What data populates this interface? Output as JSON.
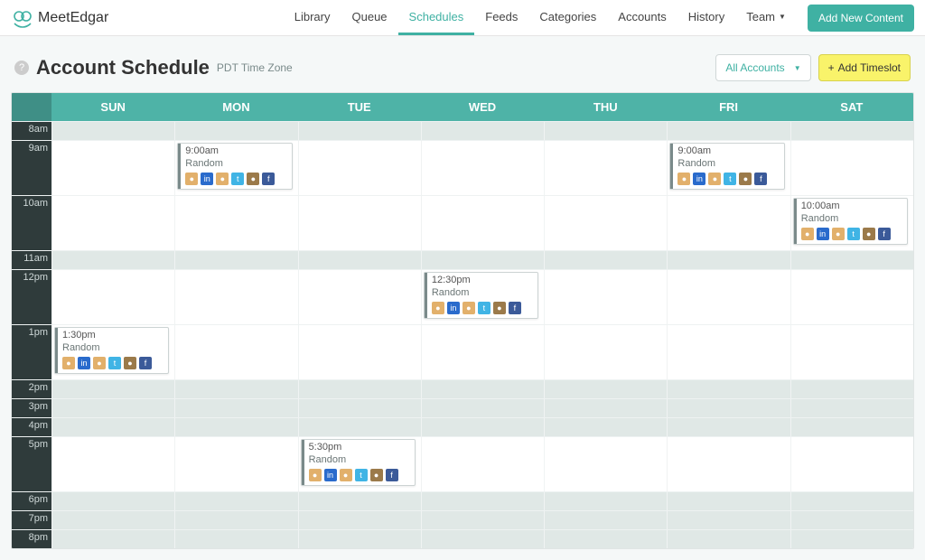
{
  "brand": {
    "name": "MeetEdgar"
  },
  "nav": {
    "items": [
      "Library",
      "Queue",
      "Schedules",
      "Feeds",
      "Categories",
      "Accounts",
      "History",
      "Team"
    ],
    "active": "Schedules",
    "addContent": "Add New Content"
  },
  "page": {
    "title": "Account Schedule",
    "tz": "PDT Time Zone",
    "accountsFilter": "All Accounts",
    "addTimeslot": "Add Timeslot"
  },
  "days": [
    "SUN",
    "MON",
    "TUE",
    "WED",
    "THU",
    "FRI",
    "SAT"
  ],
  "hours": [
    "8am",
    "9am",
    "10am",
    "11am",
    "12pm",
    "1pm",
    "2pm",
    "3pm",
    "4pm",
    "5pm",
    "6pm",
    "7pm",
    "8pm"
  ],
  "timeslots": [
    {
      "day": "MON",
      "hour": "9am",
      "time": "9:00am",
      "label": "Random"
    },
    {
      "day": "FRI",
      "hour": "9am",
      "time": "9:00am",
      "label": "Random"
    },
    {
      "day": "SAT",
      "hour": "10am",
      "time": "10:00am",
      "label": "Random"
    },
    {
      "day": "WED",
      "hour": "12pm",
      "time": "12:30pm",
      "label": "Random"
    },
    {
      "day": "SUN",
      "hour": "1pm",
      "time": "1:30pm",
      "label": "Random"
    },
    {
      "day": "TUE",
      "hour": "5pm",
      "time": "5:30pm",
      "label": "Random"
    }
  ],
  "smallRows": [
    "8am",
    "11am",
    "2pm",
    "3pm",
    "4pm",
    "6pm",
    "7pm",
    "8pm"
  ],
  "iconSet": [
    {
      "cls": "ic-a",
      "g": "●"
    },
    {
      "cls": "ic-li",
      "g": "in"
    },
    {
      "cls": "ic-a",
      "g": "●"
    },
    {
      "cls": "ic-tw",
      "g": "t"
    },
    {
      "cls": "ic-b",
      "g": "●"
    },
    {
      "cls": "ic-fb",
      "g": "f"
    }
  ]
}
